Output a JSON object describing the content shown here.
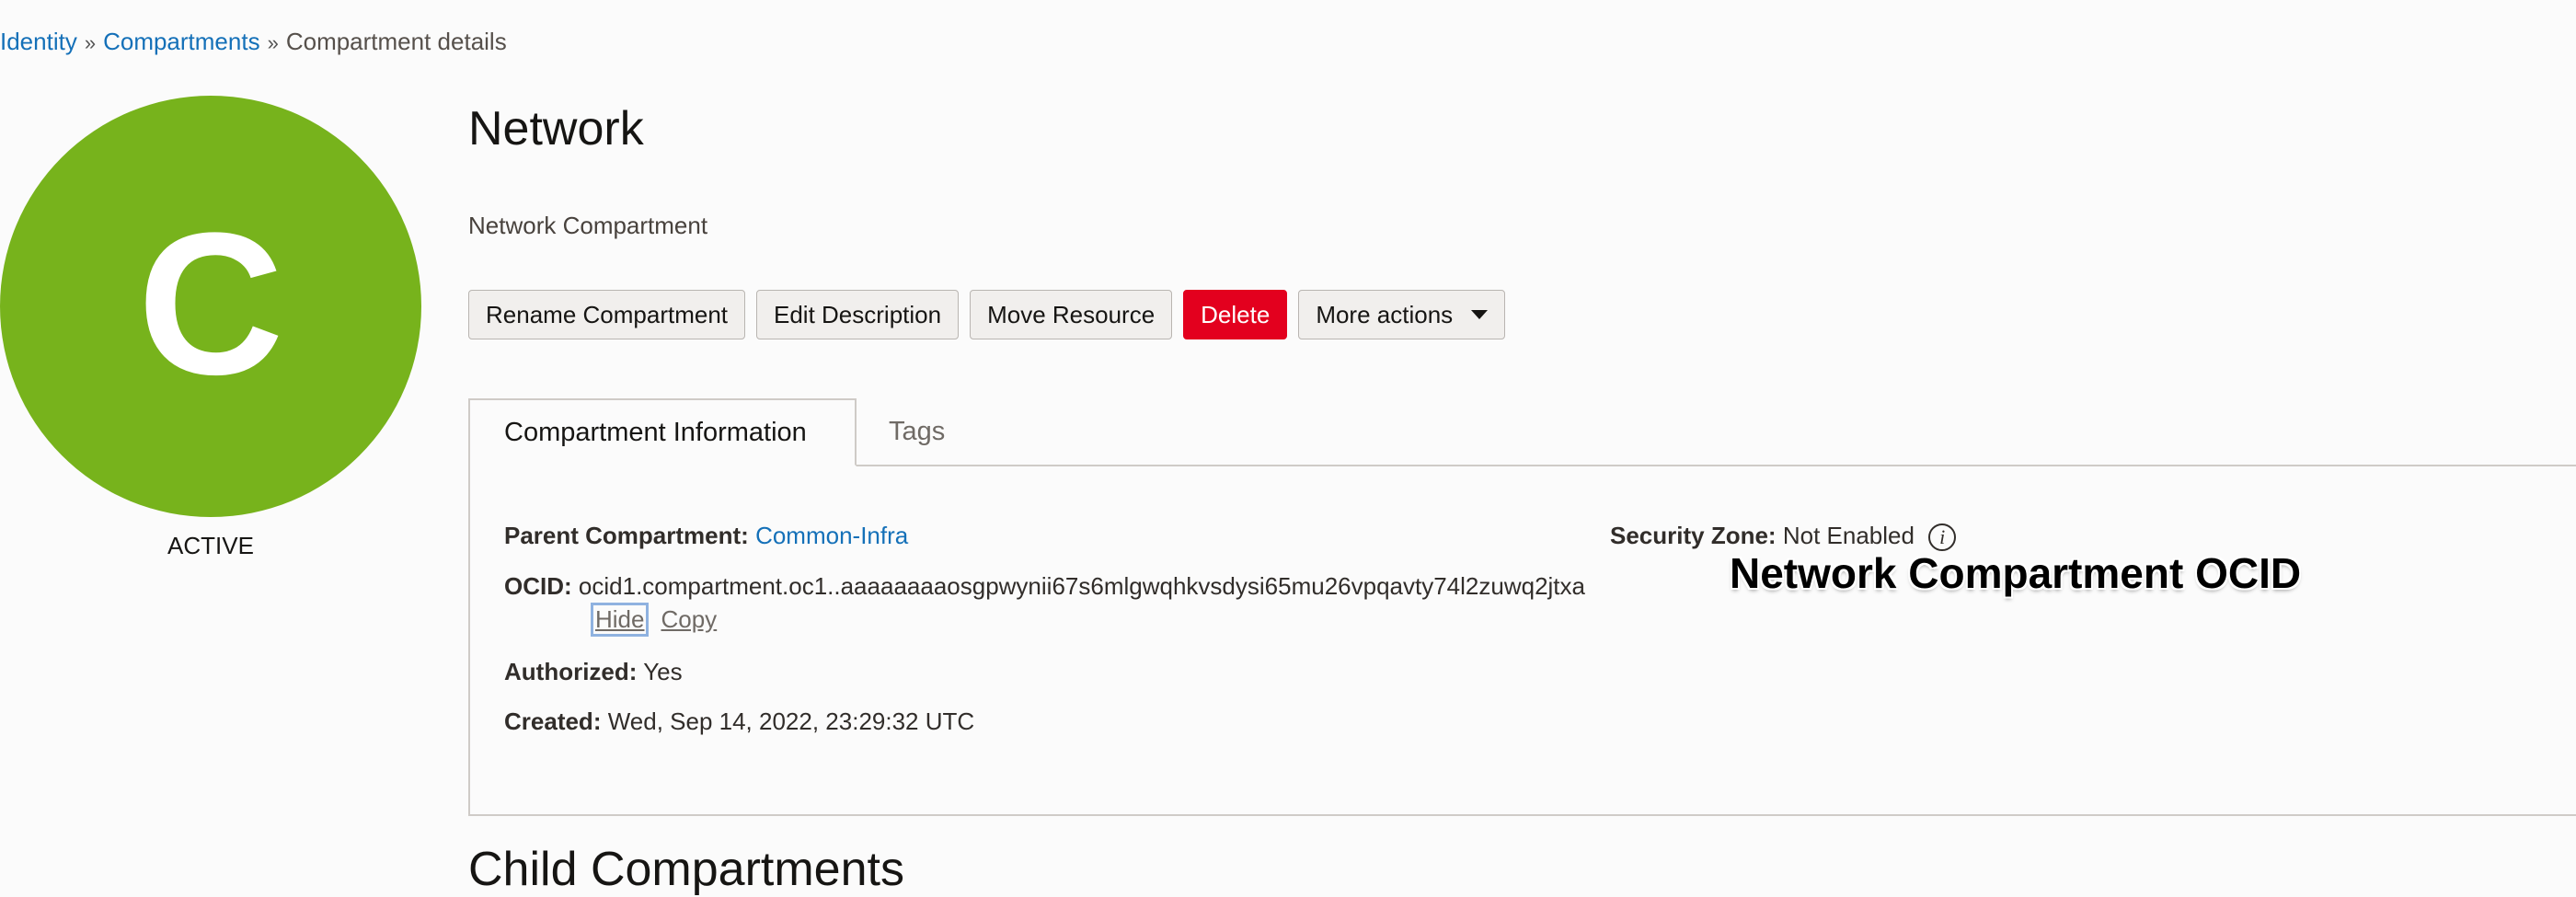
{
  "breadcrumb": {
    "items": [
      "Identity",
      "Compartments"
    ],
    "separator": "»",
    "current": "Compartment details"
  },
  "avatar": {
    "letter": "C",
    "color": "#77b31c"
  },
  "lifecycle_state": "ACTIVE",
  "page": {
    "title": "Network",
    "description": "Network Compartment"
  },
  "actions": {
    "rename": "Rename Compartment",
    "edit_description": "Edit Description",
    "move_resource": "Move Resource",
    "delete": "Delete",
    "more_actions": "More actions"
  },
  "tabs": [
    {
      "label": "Compartment Information",
      "active": true
    },
    {
      "label": "Tags",
      "active": false
    }
  ],
  "info": {
    "parent_label": "Parent Compartment:",
    "parent_value": "Common-Infra",
    "ocid_label": "OCID:",
    "ocid_value": "ocid1.compartment.oc1..aaaaaaaaosgpwynii67s6mlgwqhkvsdysi65mu26vpqavty74l2zuwq2jtxa",
    "hide_link": "Hide",
    "copy_link": "Copy",
    "authorized_label": "Authorized:",
    "authorized_value": "Yes",
    "created_label": "Created:",
    "created_value": "Wed, Sep 14, 2022, 23:29:32 UTC",
    "security_zone_label": "Security Zone:",
    "security_zone_value": "Not Enabled",
    "info_icon": "i"
  },
  "annotation": "Network Compartment OCID",
  "next_section_heading": "Child Compartments",
  "colors": {
    "link": "#1470b8",
    "danger": "#e3001e",
    "avatar": "#77b31c"
  }
}
